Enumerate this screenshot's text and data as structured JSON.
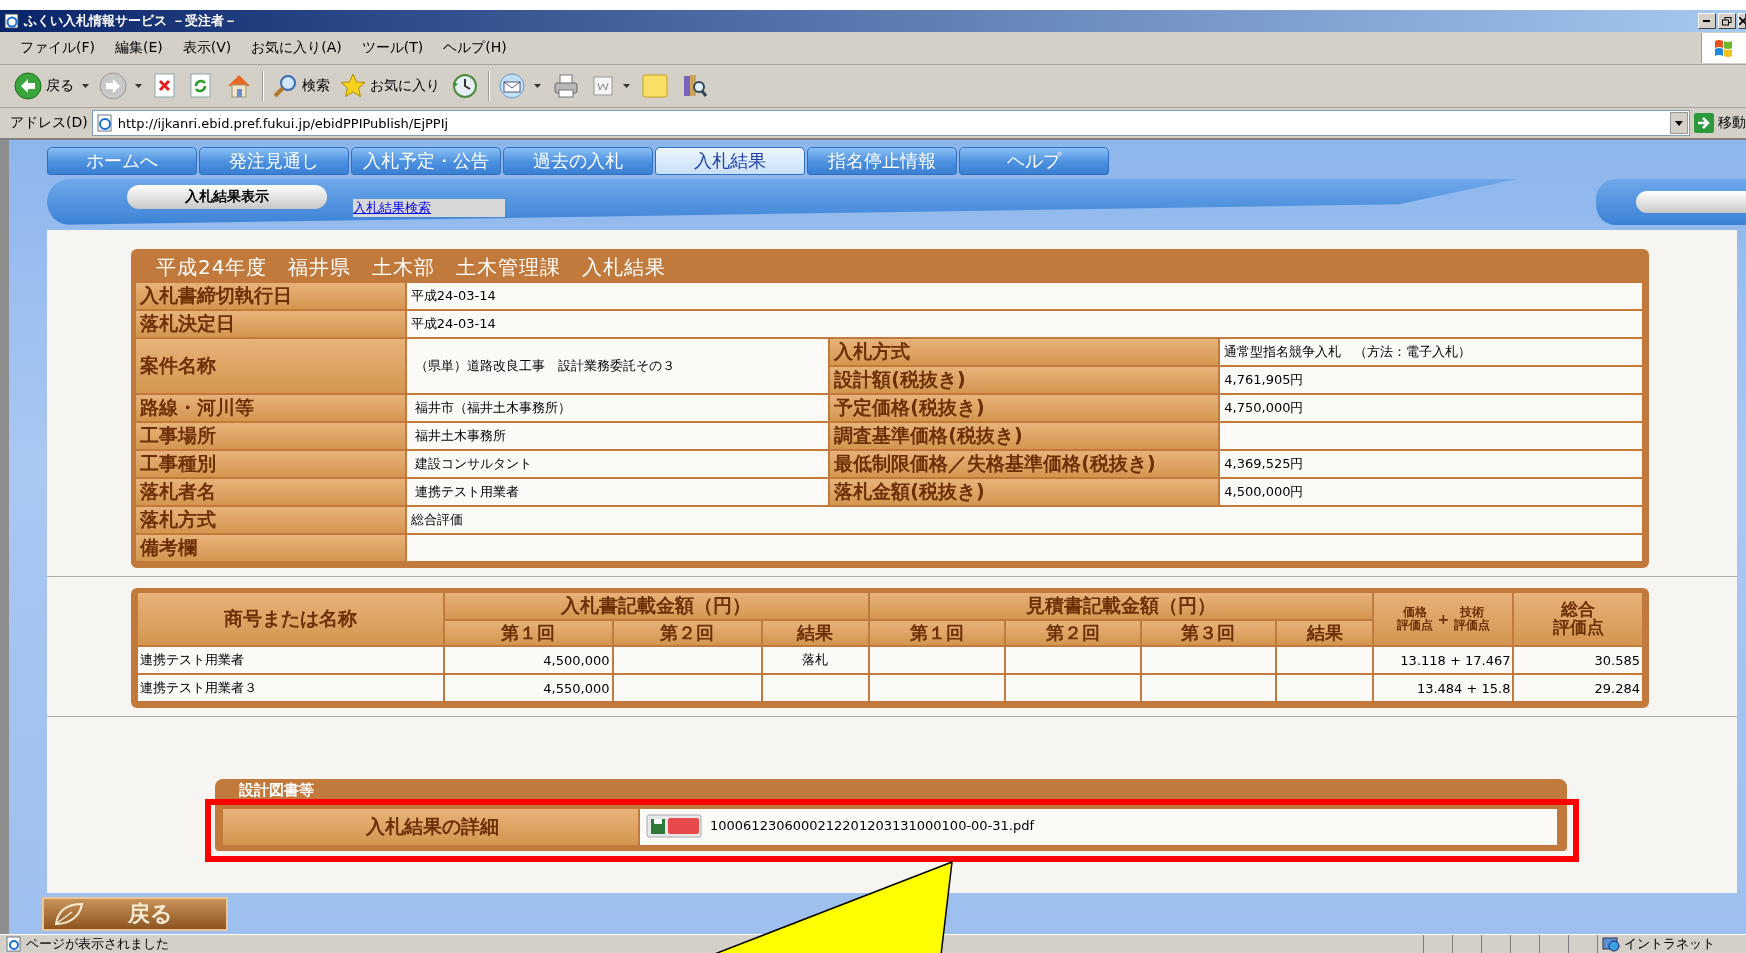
{
  "window": {
    "title": "ふくい入札情報サービス －受注者－"
  },
  "menu_bar": [
    "ファイル(F)",
    "編集(E)",
    "表示(V)",
    "お気に入り(A)",
    "ツール(T)",
    "ヘルプ(H)"
  ],
  "toolbar": {
    "back": "戻る",
    "search": "検索",
    "favorites": "お気に入り"
  },
  "address_bar": {
    "label": "アドレス(D)",
    "url": "http://ijkanri.ebid.pref.fukui.jp/ebidPPIPublish/EjPPIj",
    "go": "移動"
  },
  "nav_tabs": [
    {
      "label": "ホームへ",
      "selected": false
    },
    {
      "label": "発注見通し",
      "selected": false
    },
    {
      "label": "入札予定・公告",
      "selected": false
    },
    {
      "label": "過去の入札",
      "selected": false
    },
    {
      "label": "入札結果",
      "selected": true
    },
    {
      "label": "指名停止情報",
      "selected": false
    },
    {
      "label": "ヘルプ",
      "selected": false
    }
  ],
  "sub_nav": {
    "current": "入札結果表示",
    "link": "入札結果検索"
  },
  "result": {
    "title": "平成24年度　福井県　土木部　土木管理課　入札結果",
    "rows": [
      {
        "kind": "full",
        "label": "入札書締切執行日",
        "value": "平成24-03-14"
      },
      {
        "kind": "full",
        "label": "落札決定日",
        "value": "平成24-03-14"
      },
      {
        "kind": "pair",
        "label": "案件名称",
        "value": "（県単）道路改良工事　設計業務委託その３",
        "right": [
          {
            "label": "入札方式",
            "value": "通常型指名競争入札　（方法：電子入札）"
          },
          {
            "label": "設計額(税抜き)",
            "value": "4,761,905円"
          }
        ]
      },
      {
        "kind": "pair",
        "label": "路線・河川等",
        "value": "福井市（福井土木事務所）",
        "right": [
          {
            "label": "予定価格(税抜き)",
            "value": "4,750,000円"
          }
        ]
      },
      {
        "kind": "pair",
        "label": "工事場所",
        "value": "福井土木事務所",
        "right": [
          {
            "label": "調査基準価格(税抜き)"
          }
        ]
      },
      {
        "kind": "pair",
        "label": "工事種別",
        "value": "建設コンサルタント",
        "right": [
          {
            "label": "最低制限価格／失格基準価格(税抜き)",
            "value": "4,369,525円"
          }
        ]
      },
      {
        "kind": "pair",
        "label": "落札者名",
        "value": "連携テスト用業者",
        "right": [
          {
            "label": "落札金額(税抜き)",
            "value": "4,500,000円"
          }
        ]
      },
      {
        "kind": "full",
        "label": "落札方式",
        "value": "総合評価"
      },
      {
        "kind": "full",
        "label": "備考欄"
      }
    ]
  },
  "bids": {
    "header": {
      "name": "商号または名称",
      "bid_group": "入札書記載金額（円）",
      "bid_rounds": [
        "第１回",
        "第２回",
        "結果"
      ],
      "estimate_group": "見積書記載金額（円）",
      "estimate_rounds": [
        "第１回",
        "第２回",
        "第３回",
        "結果"
      ],
      "price_score": [
        "価格",
        "評価点"
      ],
      "plus": "+",
      "tech_score": [
        "技術",
        "評価点"
      ],
      "total": [
        "総合",
        "評価点"
      ]
    },
    "rows": [
      {
        "name": "連携テスト用業者",
        "bid_1": "4,500,000",
        "bid_result": "落札",
        "score": "13.118 + 17.467",
        "total": "30.585"
      },
      {
        "name": "連携テスト用業者３",
        "bid_1": "4,550,000",
        "score": "13.484 + 15.8",
        "total": "29.284"
      }
    ]
  },
  "documents": {
    "title": "設計図書等",
    "rows": [
      {
        "label": "入札結果の詳細",
        "file": "1000612306000212201203131000100-00-31.pdf"
      }
    ]
  },
  "back_button": "戻る",
  "status_bar": {
    "text": "ページが表示されました",
    "zone": "イントラネット"
  },
  "annotations": [
    {
      "kind": "highlight-box",
      "color": "#ff0000"
    },
    {
      "kind": "callout",
      "color": "#ffff00"
    }
  ]
}
